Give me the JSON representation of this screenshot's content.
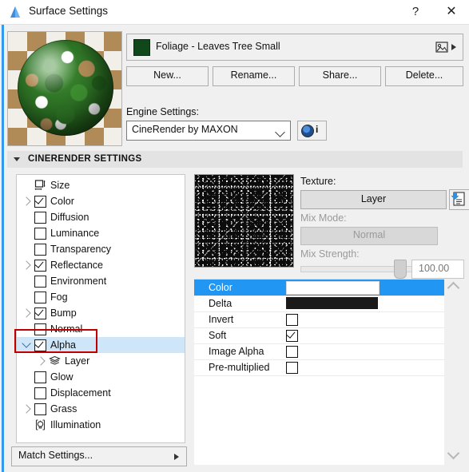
{
  "window": {
    "title": "Surface Settings",
    "icon": "surface-settings-icon",
    "help_label": "?",
    "close_label": "✕"
  },
  "preview": {
    "name": "material-preview-sphere",
    "description": "Foliage leaves sphere on checkerboard"
  },
  "material": {
    "swatch_color": "#11481b",
    "name": "Foliage - Leaves Tree Small",
    "image_icon": "picture-icon",
    "arrow_icon": "triangle-right-icon"
  },
  "actions": [
    {
      "label": "New..."
    },
    {
      "label": "Rename..."
    },
    {
      "label": "Share..."
    },
    {
      "label": "Delete..."
    }
  ],
  "engine": {
    "label": "Engine Settings:",
    "selected": "CineRender by MAXON",
    "options": [
      "CineRender by MAXON"
    ],
    "info_button_icon": "render-sphere-icon",
    "info_badge": "i"
  },
  "section": {
    "title": "CINERENDER SETTINGS",
    "expanded": true
  },
  "tree": {
    "items": [
      {
        "label": "Size",
        "icon": "size-icon",
        "has_checkbox": false,
        "checked": false,
        "twisty": "none",
        "indent": 0,
        "selected": false
      },
      {
        "label": "Color",
        "icon": null,
        "has_checkbox": true,
        "checked": true,
        "twisty": "closed",
        "indent": 0,
        "selected": false
      },
      {
        "label": "Diffusion",
        "icon": null,
        "has_checkbox": true,
        "checked": false,
        "twisty": "none",
        "indent": 0,
        "selected": false
      },
      {
        "label": "Luminance",
        "icon": null,
        "has_checkbox": true,
        "checked": false,
        "twisty": "none",
        "indent": 0,
        "selected": false
      },
      {
        "label": "Transparency",
        "icon": null,
        "has_checkbox": true,
        "checked": false,
        "twisty": "none",
        "indent": 0,
        "selected": false
      },
      {
        "label": "Reflectance",
        "icon": null,
        "has_checkbox": true,
        "checked": true,
        "twisty": "closed",
        "indent": 0,
        "selected": false
      },
      {
        "label": "Environment",
        "icon": null,
        "has_checkbox": true,
        "checked": false,
        "twisty": "none",
        "indent": 0,
        "selected": false
      },
      {
        "label": "Fog",
        "icon": null,
        "has_checkbox": true,
        "checked": false,
        "twisty": "none",
        "indent": 0,
        "selected": false
      },
      {
        "label": "Bump",
        "icon": null,
        "has_checkbox": true,
        "checked": true,
        "twisty": "closed",
        "indent": 0,
        "selected": false
      },
      {
        "label": "Normal",
        "icon": null,
        "has_checkbox": true,
        "checked": false,
        "twisty": "none",
        "indent": 0,
        "selected": false
      },
      {
        "label": "Alpha",
        "icon": null,
        "has_checkbox": true,
        "checked": true,
        "twisty": "open",
        "indent": 0,
        "selected": true
      },
      {
        "label": "Layer",
        "icon": "layers-icon",
        "has_checkbox": false,
        "checked": false,
        "twisty": "closed",
        "indent": 1,
        "selected": false
      },
      {
        "label": "Glow",
        "icon": null,
        "has_checkbox": true,
        "checked": false,
        "twisty": "none",
        "indent": 0,
        "selected": false
      },
      {
        "label": "Displacement",
        "icon": null,
        "has_checkbox": true,
        "checked": false,
        "twisty": "none",
        "indent": 0,
        "selected": false
      },
      {
        "label": "Grass",
        "icon": null,
        "has_checkbox": true,
        "checked": false,
        "twisty": "closed",
        "indent": 0,
        "selected": false
      },
      {
        "label": "Illumination",
        "icon": "illumination-icon",
        "has_checkbox": false,
        "checked": false,
        "twisty": "none",
        "indent": 0,
        "selected": false
      }
    ],
    "highlight_color": "#c00000",
    "selection_color": "#cfe6f8"
  },
  "match_settings": {
    "label": "Match Settings...",
    "arrow_icon": "triangle-right-icon"
  },
  "right_panel": {
    "texture_preview_name": "alpha-noise-texture-preview",
    "texture_label": "Texture:",
    "texture_value": "Layer",
    "texture_load_icon": "load-texture-icon",
    "mix_mode_label": "Mix Mode:",
    "mix_mode_value": "Normal",
    "mix_strength_label": "Mix Strength:",
    "mix_strength_value": "100.00",
    "mix_strength_percent": 100,
    "properties": [
      {
        "name": "Color",
        "type": "color",
        "value": "#ffffff",
        "selected": true
      },
      {
        "name": "Delta",
        "type": "color",
        "value": "#1a1a1a",
        "selected": false
      },
      {
        "name": "Invert",
        "type": "checkbox",
        "checked": false,
        "selected": false
      },
      {
        "name": "Soft",
        "type": "checkbox",
        "checked": true,
        "selected": false
      },
      {
        "name": "Image Alpha",
        "type": "checkbox",
        "checked": false,
        "selected": false
      },
      {
        "name": "Pre-multiplied",
        "type": "checkbox",
        "checked": false,
        "selected": false
      }
    ],
    "scroll_up_icon": "chevron-up-icon",
    "scroll_down_icon": "chevron-down-icon"
  }
}
